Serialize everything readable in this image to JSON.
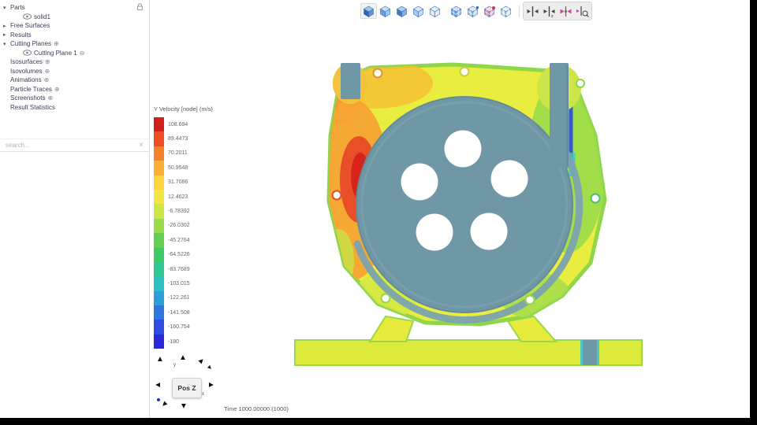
{
  "sidebar": {
    "tree": [
      {
        "label": "Parts",
        "level": 0,
        "chevron": "down",
        "eye": false,
        "suffix": null
      },
      {
        "label": "solid1",
        "level": 1,
        "chevron": null,
        "eye": true,
        "suffix": null
      },
      {
        "label": "Free Surfaces",
        "level": 0,
        "chevron": "right",
        "eye": false,
        "suffix": null
      },
      {
        "label": "Results",
        "level": 0,
        "chevron": "right",
        "eye": false,
        "suffix": null
      },
      {
        "label": "Cutting Planes",
        "level": 0,
        "chevron": "down",
        "eye": false,
        "suffix": "plus"
      },
      {
        "label": "Cutting Plane 1",
        "level": 1,
        "chevron": null,
        "eye": true,
        "suffix": "minus"
      },
      {
        "label": "Isosurfaces",
        "level": 0,
        "chevron": null,
        "eye": false,
        "suffix": "plus"
      },
      {
        "label": "Isovolumes",
        "level": 0,
        "chevron": null,
        "eye": false,
        "suffix": "plus"
      },
      {
        "label": "Animations",
        "level": 0,
        "chevron": null,
        "eye": false,
        "suffix": "plus"
      },
      {
        "label": "Particle Traces",
        "level": 0,
        "chevron": null,
        "eye": false,
        "suffix": "plus"
      },
      {
        "label": "Screenshots",
        "level": 0,
        "chevron": null,
        "eye": false,
        "suffix": "plus"
      },
      {
        "label": "Result Statistics",
        "level": 0,
        "chevron": null,
        "eye": false,
        "suffix": null
      }
    ],
    "search_placeholder": "search...",
    "clear_glyph": "×"
  },
  "toolbar": {
    "groups": [
      {
        "name": "display-modes",
        "selected": false,
        "icons": [
          {
            "name": "solid-view-icon",
            "type": "cube-solid",
            "selected": true
          },
          {
            "name": "smooth-shade-view-icon",
            "type": "cube-light",
            "selected": false
          },
          {
            "name": "flat-shade-view-icon",
            "type": "cube-mid",
            "selected": false
          },
          {
            "name": "translucent-view-icon",
            "type": "cube-trans",
            "selected": false
          },
          {
            "name": "outline-view-icon",
            "type": "cube-outline",
            "selected": false
          }
        ]
      },
      {
        "name": "mesh-modes",
        "selected": false,
        "icons": [
          {
            "name": "surface-mesh-view-icon",
            "type": "cube-grid",
            "selected": false
          },
          {
            "name": "surface-mesh-edges-icon",
            "type": "cube-grid-edges",
            "selected": false
          },
          {
            "name": "surface-mesh-red-icon",
            "type": "cube-grid-red",
            "selected": false
          },
          {
            "name": "surface-mesh-outline-icon",
            "type": "cube-grid-outline",
            "selected": false
          }
        ]
      },
      {
        "name": "cutting-plane-tools",
        "selected": true,
        "icons": [
          {
            "name": "snap-plane-icon",
            "type": "plane-snap",
            "selected": false
          },
          {
            "name": "snap-plane-axis-icon",
            "type": "plane-snap-z",
            "selected": false
          },
          {
            "name": "flip-plane-icon",
            "type": "plane-flip",
            "selected": false
          },
          {
            "name": "plane-zoom-icon",
            "type": "plane-zoom",
            "selected": false
          }
        ]
      }
    ]
  },
  "legend": {
    "title": "Y Velocity [node] (m/s)",
    "entries": [
      {
        "label": "108.694",
        "color": "#d1201c"
      },
      {
        "label": "89.4473",
        "color": "#ee4c22"
      },
      {
        "label": "70.2011",
        "color": "#f87f2b"
      },
      {
        "label": "50.9548",
        "color": "#fbaf35"
      },
      {
        "label": "31.7086",
        "color": "#fad43c"
      },
      {
        "label": "12.4623",
        "color": "#f2e742"
      },
      {
        "label": "-6.78392",
        "color": "#cfe647"
      },
      {
        "label": "-26.0302",
        "color": "#9cdb4b"
      },
      {
        "label": "-45.2764",
        "color": "#66cf52"
      },
      {
        "label": "-64.5226",
        "color": "#3fca69"
      },
      {
        "label": "-83.7689",
        "color": "#2fc795"
      },
      {
        "label": "-103.015",
        "color": "#2bc1c0"
      },
      {
        "label": "-122.261",
        "color": "#2b9fd6"
      },
      {
        "label": "-141.508",
        "color": "#2d77de"
      },
      {
        "label": "-160.754",
        "color": "#2d4ee0"
      },
      {
        "label": "-180",
        "color": "#2a28d8"
      }
    ]
  },
  "viewport": {
    "time_label": "Time 1000.00000 (1000)",
    "orientation_label": "Pos Z"
  }
}
